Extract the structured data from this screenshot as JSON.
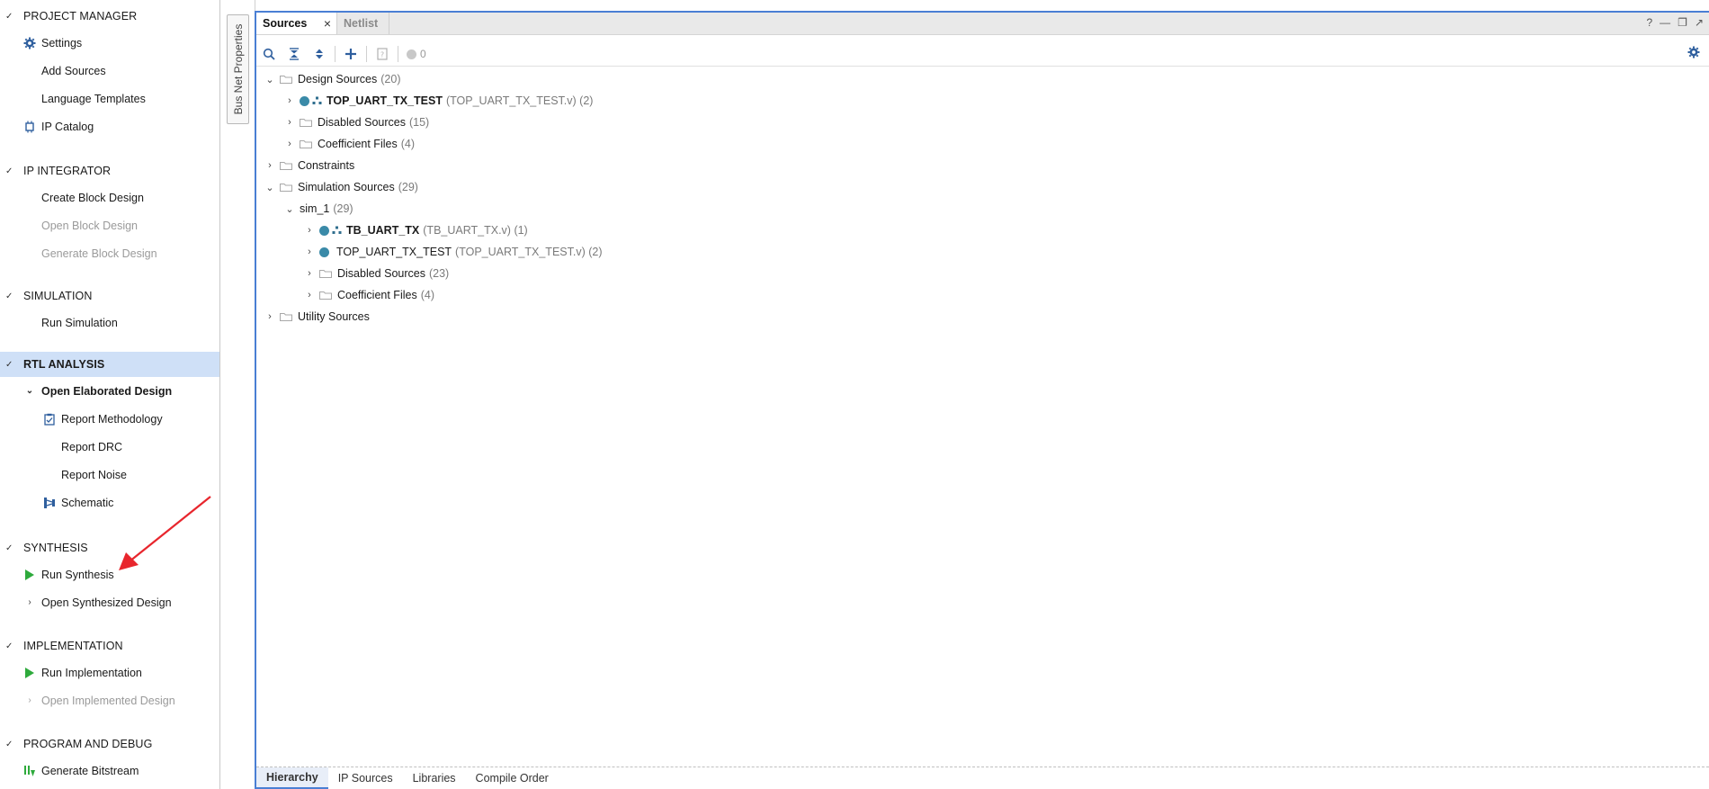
{
  "flow_navigator": {
    "sections": [
      {
        "title": "PROJECT MANAGER",
        "items": [
          {
            "label": "Settings",
            "icon": "gear-icon",
            "disabled": false
          },
          {
            "label": "Add Sources",
            "icon": "",
            "disabled": false
          },
          {
            "label": "Language Templates",
            "icon": "",
            "disabled": false
          },
          {
            "label": "IP Catalog",
            "icon": "ip-catalog-icon",
            "disabled": false
          }
        ]
      },
      {
        "title": "IP INTEGRATOR",
        "items": [
          {
            "label": "Create Block Design",
            "disabled": false
          },
          {
            "label": "Open Block Design",
            "disabled": true
          },
          {
            "label": "Generate Block Design",
            "disabled": true
          }
        ]
      },
      {
        "title": "SIMULATION",
        "items": [
          {
            "label": "Run Simulation",
            "disabled": false
          }
        ]
      },
      {
        "title": "RTL ANALYSIS",
        "selected": true,
        "items": [
          {
            "label": "Open Elaborated Design",
            "bold": true,
            "expanded": true
          },
          {
            "label": "Report Methodology",
            "icon": "report-methodology-icon"
          },
          {
            "label": "Report DRC"
          },
          {
            "label": "Report Noise"
          },
          {
            "label": "Schematic",
            "icon": "schematic-icon"
          }
        ]
      },
      {
        "title": "SYNTHESIS",
        "items": [
          {
            "label": "Run Synthesis",
            "icon": "run-play-icon"
          },
          {
            "label": "Open Synthesized Design",
            "collapsed": true
          }
        ]
      },
      {
        "title": "IMPLEMENTATION",
        "items": [
          {
            "label": "Run Implementation",
            "icon": "run-play-icon"
          },
          {
            "label": "Open Implemented Design",
            "collapsed": true,
            "disabled": true
          }
        ]
      },
      {
        "title": "PROGRAM AND DEBUG",
        "items": [
          {
            "label": "Generate Bitstream",
            "icon": "bitstream-icon"
          }
        ]
      }
    ]
  },
  "side_strip": {
    "tab_label": "Bus Net Properties"
  },
  "sources_panel": {
    "tabs": [
      {
        "label": "Sources",
        "active": true
      },
      {
        "label": "Netlist",
        "active": false
      }
    ],
    "window_controls": [
      "?",
      "_",
      "restore",
      "maximize"
    ],
    "toolbar": {
      "buttons": [
        "search-icon",
        "collapse-all-icon",
        "expand-all-icon",
        "add-icon",
        "question-doc-icon"
      ],
      "status_count": "0"
    },
    "tree": [
      {
        "label": "Design Sources",
        "meta": "(20)",
        "level": 0,
        "expanded": true,
        "type": "folder"
      },
      {
        "label": "TOP_UART_TX_TEST",
        "meta": "(TOP_UART_TX_TEST.v) (2)",
        "level": 1,
        "expanded": false,
        "type": "top-module",
        "bold": true
      },
      {
        "label": "Disabled Sources",
        "meta": "(15)",
        "level": 1,
        "expanded": false,
        "type": "folder"
      },
      {
        "label": "Coefficient Files",
        "meta": "(4)",
        "level": 1,
        "expanded": false,
        "type": "folder"
      },
      {
        "label": "Constraints",
        "meta": "",
        "level": 0,
        "expanded": false,
        "type": "folder"
      },
      {
        "label": "Simulation Sources",
        "meta": "(29)",
        "level": 0,
        "expanded": true,
        "type": "folder"
      },
      {
        "label": "sim_1",
        "meta": "(29)",
        "level": 1,
        "expanded": true,
        "type": "plain"
      },
      {
        "label": "TB_UART_TX",
        "meta": "(TB_UART_TX.v) (1)",
        "level": 2,
        "expanded": false,
        "type": "top-module",
        "bold": true
      },
      {
        "label": "TOP_UART_TX_TEST",
        "meta": "(TOP_UART_TX_TEST.v) (2)",
        "level": 2,
        "expanded": false,
        "type": "module"
      },
      {
        "label": "Disabled Sources",
        "meta": "(23)",
        "level": 2,
        "expanded": false,
        "type": "folder"
      },
      {
        "label": "Coefficient Files",
        "meta": "(4)",
        "level": 2,
        "expanded": false,
        "type": "folder"
      },
      {
        "label": "Utility Sources",
        "meta": "",
        "level": 0,
        "expanded": false,
        "type": "folder"
      }
    ],
    "bottom_tabs": [
      {
        "label": "Hierarchy",
        "active": true
      },
      {
        "label": "IP Sources",
        "active": false
      },
      {
        "label": "Libraries",
        "active": false
      },
      {
        "label": "Compile Order",
        "active": false
      }
    ]
  },
  "colors": {
    "selection": "#cfe0f7",
    "accent_blue": "#4a7fd4",
    "module_dot": "#3a8aa8",
    "run_green": "#2eaa3c",
    "annotation_red": "#e8262d"
  }
}
